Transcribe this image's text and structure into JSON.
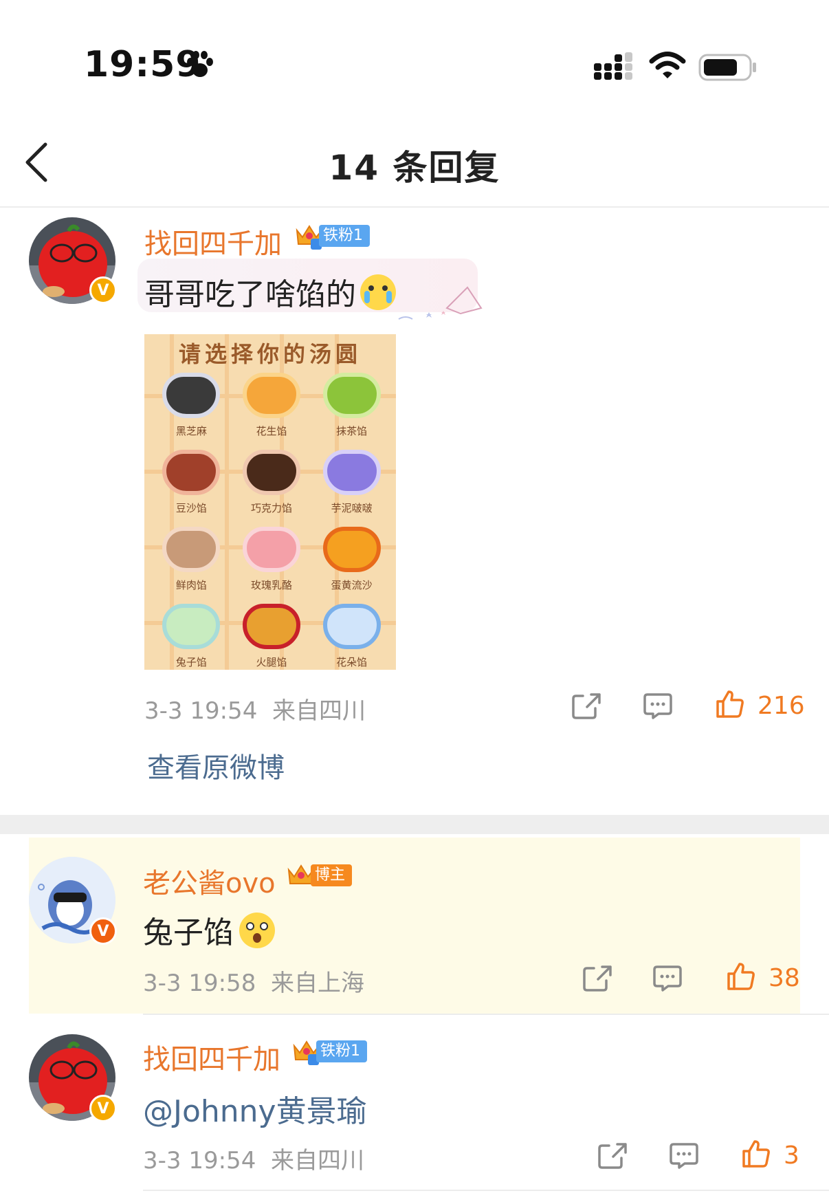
{
  "status_bar": {
    "time": "19:59"
  },
  "header": {
    "title": "14 条回复"
  },
  "post": {
    "username": "找回四千加",
    "fan_badge": "铁粉1",
    "text": "哥哥吃了啥馅的",
    "image": {
      "title": "请选择你的汤圆",
      "flavors": [
        "黑芝麻",
        "花生馅",
        "抹茶馅",
        "豆沙馅",
        "巧克力馅",
        "芋泥啵啵",
        "鲜肉馅",
        "玫瑰乳酪",
        "蛋黄流沙",
        "兔子馅",
        "火腿馅",
        "花朵馅"
      ]
    },
    "date": "3-3 19:54",
    "location": "来自四川",
    "likes": "216",
    "view_original": "查看原微博"
  },
  "replies": [
    {
      "username": "老公酱ovo",
      "badge": "博主",
      "text": "兔子馅",
      "date": "3-3 19:58",
      "location": "来自上海",
      "likes": "38"
    },
    {
      "username": "找回四千加",
      "badge": "铁粉1",
      "text": "@Johnny黄景瑜",
      "date": "3-3 19:54",
      "location": "来自四川",
      "likes": "3"
    }
  ],
  "colors": {
    "username": "#e8762c",
    "like": "#f07a22",
    "link": "#4b6b8f",
    "highlight": "#fefbe7"
  }
}
